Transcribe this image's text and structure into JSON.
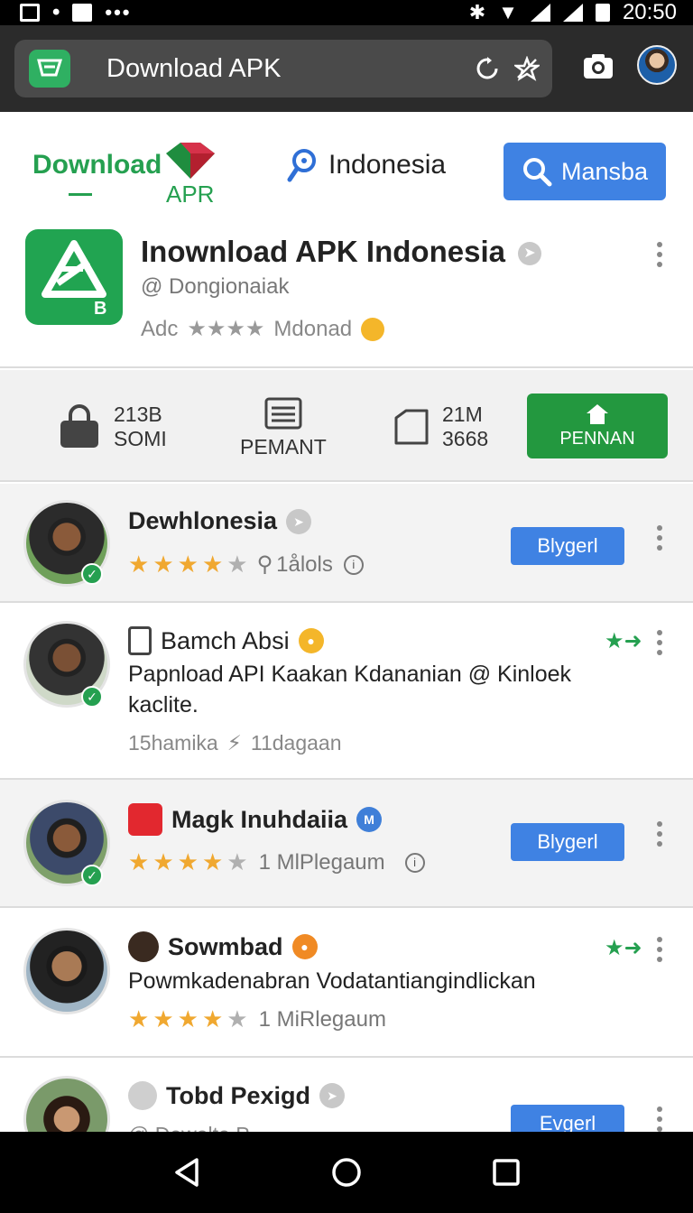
{
  "status_bar": {
    "time": "20:50",
    "left_icons": [
      "gallery-icon",
      "notification-icon",
      "app-icon",
      "more-dots-icon"
    ],
    "right_icons": [
      "bluetooth-icon",
      "wifi-icon",
      "signal-icon",
      "signal-icon",
      "battery-icon"
    ]
  },
  "browser": {
    "title": "Download APK",
    "icons": [
      "refresh-icon",
      "share-icon",
      "camera-icon",
      "profile-avatar"
    ]
  },
  "header": {
    "brand_line1": "Download",
    "brand_line2": "APR",
    "region": "Indonesia",
    "search_label": "Mansba"
  },
  "app": {
    "name": "Inownload APK Indonesia",
    "handle": "@ Dongionaiak",
    "meta_prefix": "Adс",
    "meta_suffix": "Mdonad"
  },
  "stats": {
    "downloads_value": "213B",
    "downloads_label": "SOMI",
    "permissions_label": "PEMANT",
    "size_value": "21M",
    "size_label": "3668",
    "install_label": "PENNAN"
  },
  "list": [
    {
      "name": "Dewhlonesia",
      "rating": 4,
      "meta": "1ålols",
      "button": "Blygerl"
    },
    {
      "name": "Bamch Absi",
      "desc": "Papnload API Kaakan Kdananian @ Kinloek kaclite.",
      "sub_left": "15hamika",
      "sub_right": "11dagaan"
    },
    {
      "name": "Magk Inuhdaiia",
      "badge_text": "M",
      "rating": 4,
      "meta": "1 MlPlegaum",
      "button": "Blygerl"
    },
    {
      "name": "Sowmbad",
      "desc": "Powmkadenabran Vodatantiangindlickan",
      "rating": 4,
      "meta": "1 MiRlegaum"
    },
    {
      "name": "Tobd Pexigd",
      "sub_left": "@ Dewalte P",
      "button": "Evgerl"
    }
  ],
  "colors": {
    "accent_green": "#23983f",
    "accent_blue": "#3f82e3",
    "star": "#f0a830"
  }
}
